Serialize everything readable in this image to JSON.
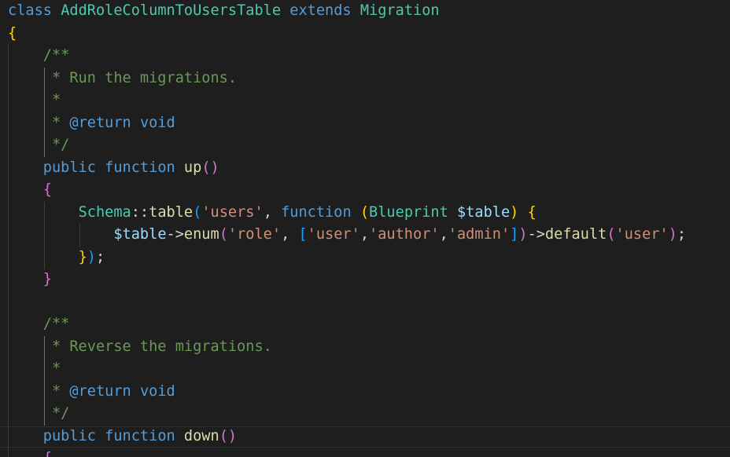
{
  "code": {
    "line1": {
      "kw_class": "class",
      "class_name": "AddRoleColumnToUsersTable",
      "kw_extends": "extends",
      "parent_class": "Migration"
    },
    "open_brace": "{",
    "doc_up": {
      "open": "/**",
      "desc": " * Run the migrations.",
      "blank": " *",
      "return_star": " * ",
      "return_tag": "@return",
      "return_type": " void",
      "close": " */"
    },
    "up_sig": {
      "kw_public": "public",
      "kw_function": "function",
      "name": "up",
      "paren_open": "(",
      "paren_close": ")"
    },
    "up_open": "{",
    "schema_line": {
      "cls": "Schema",
      "op": "::",
      "method": "table",
      "paren_open": "(",
      "table_name": "'users'",
      "comma": ", ",
      "kw_function": "function",
      "sp": " ",
      "paren2_open": "(",
      "type": "Blueprint",
      "var": "$table",
      "paren2_close": ")",
      "brace_open": "{"
    },
    "enum_line": {
      "var": "$table",
      "arrow": "->",
      "method": "enum",
      "paren_open": "(",
      "col": "'role'",
      "comma": ", ",
      "bracket_open": "[",
      "opt1": "'user'",
      "opt2": "'author'",
      "opt3": "'admin'",
      "bracket_close": "]",
      "paren_close": ")",
      "arrow2": "->",
      "method2": "default",
      "paren2_open": "(",
      "default_val": "'user'",
      "paren2_close": ")",
      "semi": ";"
    },
    "closure_close": {
      "brace": "}",
      "paren": ")",
      "semi": ";"
    },
    "up_close": "}",
    "doc_down": {
      "open": "/**",
      "desc": " * Reverse the migrations.",
      "blank": " *",
      "return_star": " * ",
      "return_tag": "@return",
      "return_type": " void",
      "close": " */"
    },
    "down_sig": {
      "kw_public": "public",
      "kw_function": "function",
      "name": "down",
      "paren_open": "(",
      "paren_close": ")"
    },
    "down_open": "{"
  },
  "colors": {
    "background": "#1e1e1e",
    "keyword": "#569cd6",
    "class_name": "#4ec9b0",
    "function_name": "#dcdcaa",
    "variable": "#9cdcfe",
    "string": "#ce9178",
    "comment": "#6a9955",
    "bracket_level1": "#ffd700",
    "bracket_level2": "#da70d6",
    "bracket_level3": "#179fff"
  }
}
